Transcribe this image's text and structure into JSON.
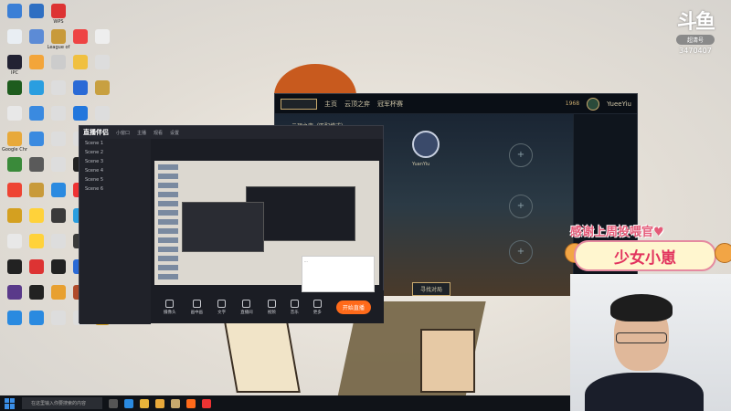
{
  "desktop": {
    "icons": [
      {
        "label": "",
        "color": "#3b7fd6"
      },
      {
        "label": "",
        "color": "#2f6fc2"
      },
      {
        "label": "WPS",
        "color": "#d33"
      },
      {
        "label": "",
        "color": "#e9eef3"
      },
      {
        "label": "",
        "color": "#5c8bd6"
      },
      {
        "label": "League of",
        "color": "#c89a3a"
      },
      {
        "label": "",
        "color": "#e44"
      },
      {
        "label": "",
        "color": "#eee"
      },
      {
        "label": "IPC",
        "color": "#223"
      },
      {
        "label": "",
        "color": "#f3a53a"
      },
      {
        "label": "",
        "color": "#ccc"
      },
      {
        "label": "",
        "color": "#f0c040"
      },
      {
        "label": "",
        "color": "#ddd"
      },
      {
        "label": "",
        "color": "#1e5c1e"
      },
      {
        "label": "",
        "color": "#2a9ee0"
      },
      {
        "label": "",
        "color": "#ddd"
      },
      {
        "label": "",
        "color": "#2a6ad6"
      },
      {
        "label": "",
        "color": "#c8a040"
      },
      {
        "label": "",
        "color": "#e8e8e8"
      },
      {
        "label": "",
        "color": "#3a8ae0"
      },
      {
        "label": "",
        "color": "#ddd"
      },
      {
        "label": "",
        "color": "#2277dd"
      },
      {
        "label": "",
        "color": "#ddd"
      },
      {
        "label": "Google Chrome",
        "color": "#e8a93a"
      },
      {
        "label": "",
        "color": "#3a8ae0"
      },
      {
        "label": "",
        "color": "#ddd"
      },
      {
        "label": "",
        "color": "#ddd"
      },
      {
        "label": "",
        "color": "#3a3a3a"
      },
      {
        "label": "",
        "color": "#3a8a3a"
      },
      {
        "label": "",
        "color": "#5a5a5a"
      },
      {
        "label": "",
        "color": "#ddd"
      },
      {
        "label": "",
        "color": "#222"
      },
      {
        "label": "",
        "color": "#3a5a9a"
      },
      {
        "label": "",
        "color": "#e43"
      },
      {
        "label": "",
        "color": "#c89a3a"
      },
      {
        "label": "",
        "color": "#2a8ae0"
      },
      {
        "label": "",
        "color": "#e33"
      },
      {
        "label": "",
        "color": "#ddd"
      },
      {
        "label": "",
        "color": "#d4a020"
      },
      {
        "label": "",
        "color": "#ffd23a"
      },
      {
        "label": "",
        "color": "#3a3a3a"
      },
      {
        "label": "",
        "color": "#2a9ee0"
      },
      {
        "label": "",
        "color": "#ddd"
      },
      {
        "label": "",
        "color": "#e8e8e8"
      },
      {
        "label": "",
        "color": "#ffd23a"
      },
      {
        "label": "",
        "color": "#ddd"
      },
      {
        "label": "",
        "color": "#3a3a3a"
      },
      {
        "label": "",
        "color": "#1c3a5a"
      },
      {
        "label": "",
        "color": "#222"
      },
      {
        "label": "",
        "color": "#d33"
      },
      {
        "label": "",
        "color": "#222"
      },
      {
        "label": "",
        "color": "#2a6ad6"
      },
      {
        "label": "",
        "color": "#333"
      },
      {
        "label": "",
        "color": "#5a3a8a"
      },
      {
        "label": "",
        "color": "#222"
      },
      {
        "label": "",
        "color": "#e8a030"
      },
      {
        "label": "",
        "color": "#b04a2a"
      },
      {
        "label": "",
        "color": "#3a8ae0"
      },
      {
        "label": "",
        "color": "#2a8ae0"
      },
      {
        "label": "",
        "color": "#2a8ae0"
      },
      {
        "label": "",
        "color": "#ddd"
      },
      {
        "label": "",
        "color": "#ddd"
      },
      {
        "label": "",
        "color": "#d4a020"
      }
    ]
  },
  "logo": {
    "mark": "斗鱼",
    "sub": "超清号",
    "room_id": "3470407"
  },
  "game_client": {
    "nav": [
      "主页",
      "云顶之弈",
      "冠军杯赛"
    ],
    "resources": "1968",
    "player": "YueeYiu",
    "lobby_title": "云顶之弈（匹配模式）",
    "lobby_player": "YuanYiu",
    "find_match": "寻找对局",
    "slot_plus": "+"
  },
  "stream_app": {
    "brand": "直播伴侣",
    "tabs": [
      "小窗口",
      "主播",
      "观看",
      "设置"
    ],
    "sources": [
      "Scene 1",
      "Scene 2",
      "Scene 3",
      "Scene 4",
      "Scene 5",
      "Scene 6"
    ],
    "tools": [
      "摄像头",
      "画中画",
      "文字",
      "直播间",
      "视频",
      "音乐",
      "更多"
    ],
    "go_live": "开始直播"
  },
  "chat": {
    "text": "..."
  },
  "overlay": {
    "thanks": "感谢上周投喂官♥",
    "name": "少女小崽"
  },
  "taskbar": {
    "search_placeholder": "在这里输入你要搜索的内容"
  }
}
